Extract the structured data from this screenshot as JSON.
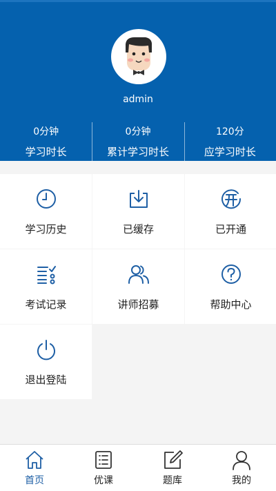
{
  "profile": {
    "username": "admin"
  },
  "stats": [
    {
      "value": "0分钟",
      "label": "学习时长"
    },
    {
      "value": "0分钟",
      "label": "累计学习时长"
    },
    {
      "value": "120分",
      "label": "应学习时长"
    }
  ],
  "menu": {
    "history": "学习历史",
    "cached": "已缓存",
    "opened": "已开通",
    "exam_records": "考试记录",
    "lecturer_recruit": "讲师招募",
    "help_center": "帮助中心",
    "logout": "退出登陆"
  },
  "tabs": {
    "home": "首页",
    "courses": "优课",
    "questions": "题库",
    "mine": "我的"
  },
  "colors": {
    "header": "#0561ae",
    "icon": "#1e5fa5",
    "active_tab": "#1e5fa5"
  }
}
